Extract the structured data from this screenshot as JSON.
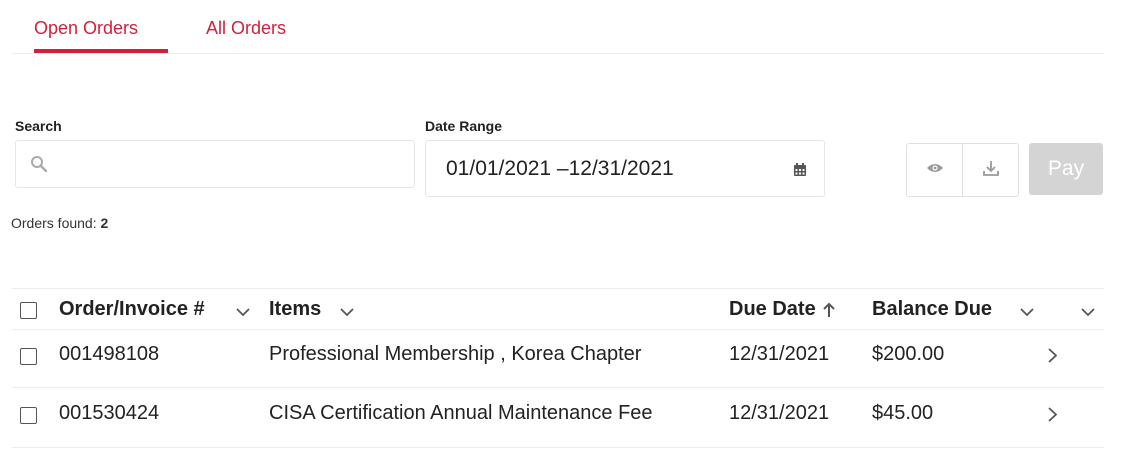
{
  "tabs": {
    "open_label": "Open Orders",
    "all_label": "All Orders"
  },
  "filters": {
    "search_label": "Search",
    "search_value": "",
    "date_range_label": "Date Range",
    "date_range_value": "01/01/2021 –12/31/2021"
  },
  "actions": {
    "view_icon": "eye-icon",
    "download_icon": "download-icon",
    "pay_label": "Pay"
  },
  "orders_found": {
    "label": "Orders found:",
    "count": "2"
  },
  "table": {
    "columns": {
      "order": "Order/Invoice #",
      "items": "Items",
      "due_date": "Due Date",
      "balance": "Balance Due"
    },
    "sort": {
      "column": "due_date",
      "direction": "ascending"
    },
    "rows": [
      {
        "order": "001498108",
        "items": "Professional Membership , Korea Chapter",
        "due_date": "12/31/2021",
        "balance": "$200.00"
      },
      {
        "order": "001530424",
        "items": "CISA Certification Annual Maintenance Fee",
        "due_date": "12/31/2021",
        "balance": "$45.00"
      }
    ]
  },
  "colors": {
    "accent": "#d0213a",
    "disabled_button": "#d4d4d4",
    "border": "#e6e6e6"
  }
}
